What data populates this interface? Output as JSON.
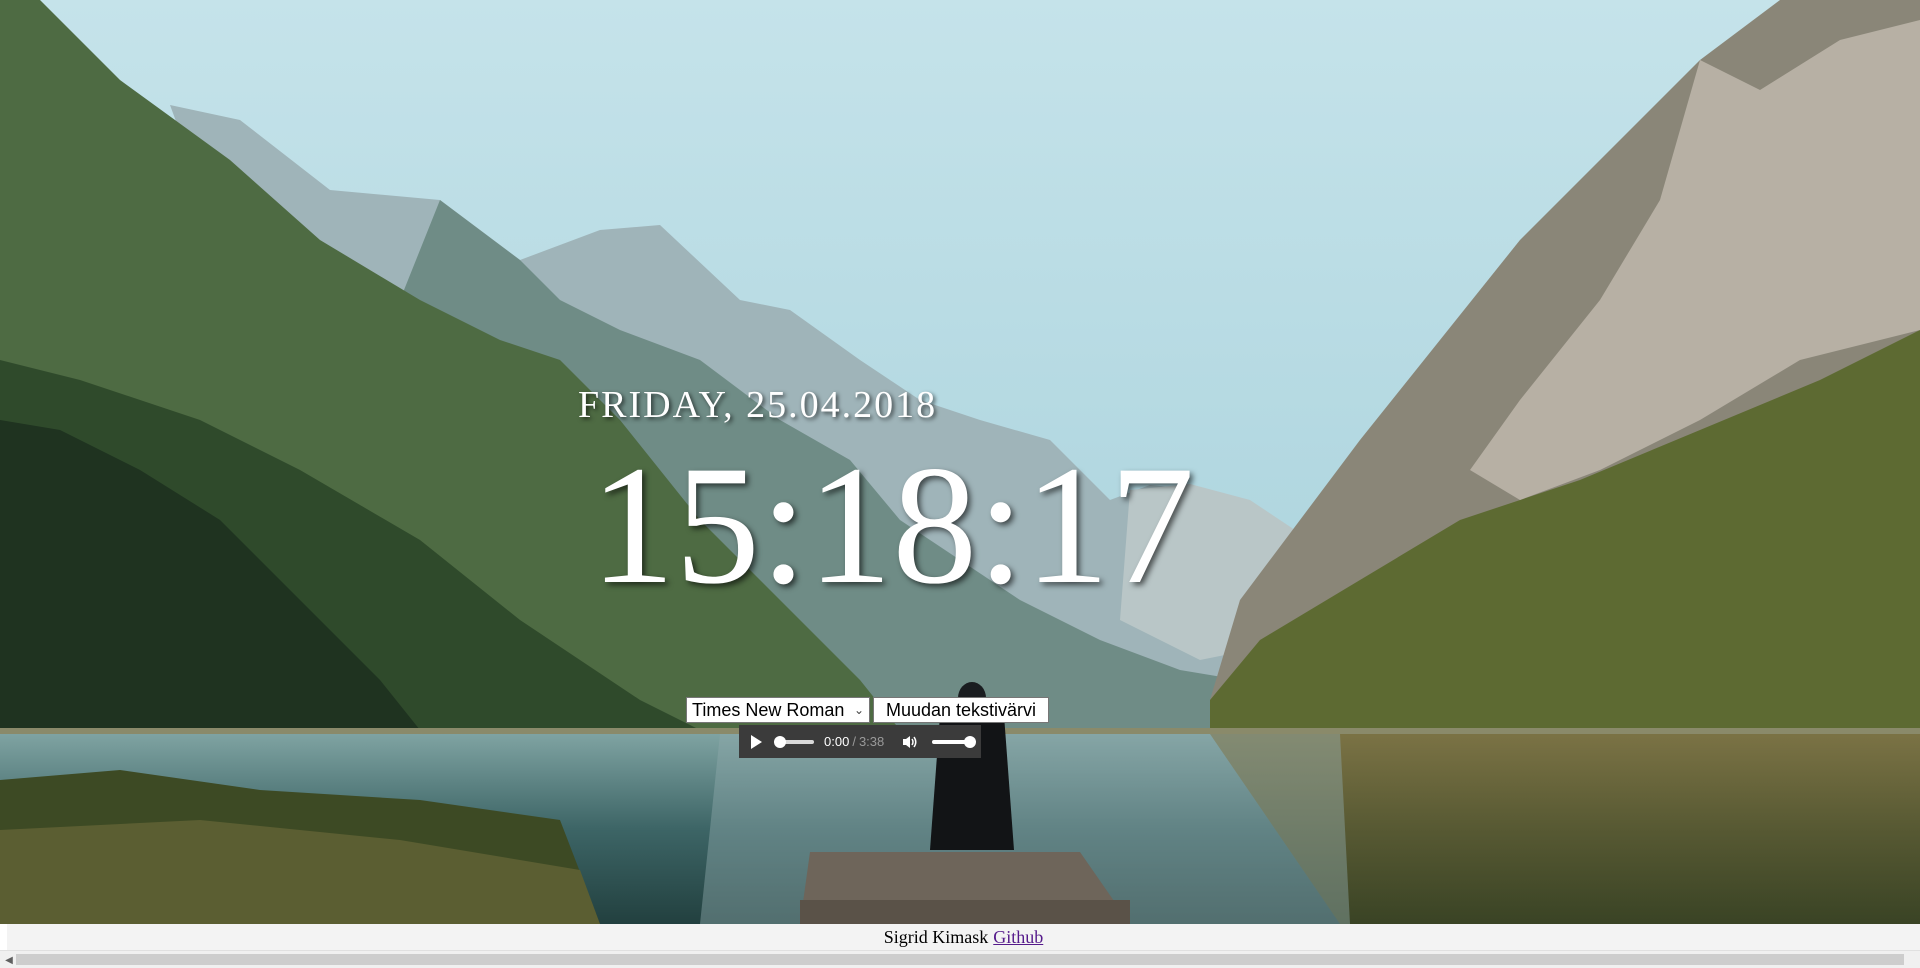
{
  "background": {
    "description_icon": "mountain-lake-photo-icon"
  },
  "date_text": "FRIDAY, 25.04.2018",
  "clock_text": "15:18:17",
  "controls": {
    "font_select_value": "Times New Roman",
    "color_button_label": "Muudan tekstivärvi"
  },
  "audio": {
    "current_time": "0:00",
    "separator": "/",
    "duration": "3:38",
    "progress_fraction": 0.0,
    "volume_fraction": 1.0
  },
  "footer": {
    "author": "Sigrid Kimask",
    "link_label": "Github"
  },
  "colors": {
    "link": "#551a8b",
    "player_bg": "#3b3b3b"
  }
}
